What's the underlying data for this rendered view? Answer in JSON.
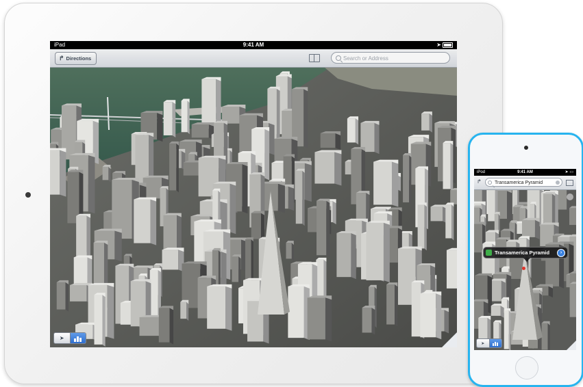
{
  "ipad": {
    "status": {
      "device": "iPad",
      "time": "9:41 AM"
    },
    "toolbar": {
      "directions_label": "Directions",
      "directions_icon": "turn-right-arrow-icon",
      "bookmarks_icon": "book-icon",
      "search_placeholder": "Search or Address",
      "search_icon": "search-icon"
    },
    "controls": {
      "location_icon": "location-arrow-icon",
      "view_icon": "3d-buildings-icon"
    }
  },
  "ipod": {
    "status": {
      "device": "iPod",
      "time": "9:41 AM"
    },
    "toolbar": {
      "directions_icon": "turn-right-arrow-icon",
      "search_value": "Transamerica Pyramid",
      "bookmarks_icon": "book-icon"
    },
    "callout": {
      "title": "Transamerica Pyramid",
      "info_glyph": "›"
    }
  },
  "colors": {
    "ipod_bezel": "#27b4ef",
    "ipad_bezel": "#f4f4f4",
    "accent_blue": "#3b82e0",
    "pin_red": "#e0352b"
  }
}
